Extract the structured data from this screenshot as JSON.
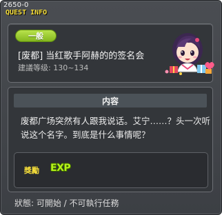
{
  "window": {
    "code": "2650-0",
    "title": "QUEST INFO"
  },
  "quest": {
    "category": "一般",
    "name": "[废都] 当红歌手阿赫的的签名会",
    "level": "建議等级: 130~134"
  },
  "content": {
    "header": "内容",
    "description": "废都广场突然有人跟我说话。艾宁……？头一次听说这个名字。到底是什么事情呢？"
  },
  "reward": {
    "label": "獎勵",
    "exp": "EXP"
  },
  "status": {
    "text": "狀態: 可開始 / 不可執行任務"
  },
  "colors": {
    "title": "#f7df3a",
    "badge": "#9ccc2f",
    "exp": "#b4f21a"
  }
}
